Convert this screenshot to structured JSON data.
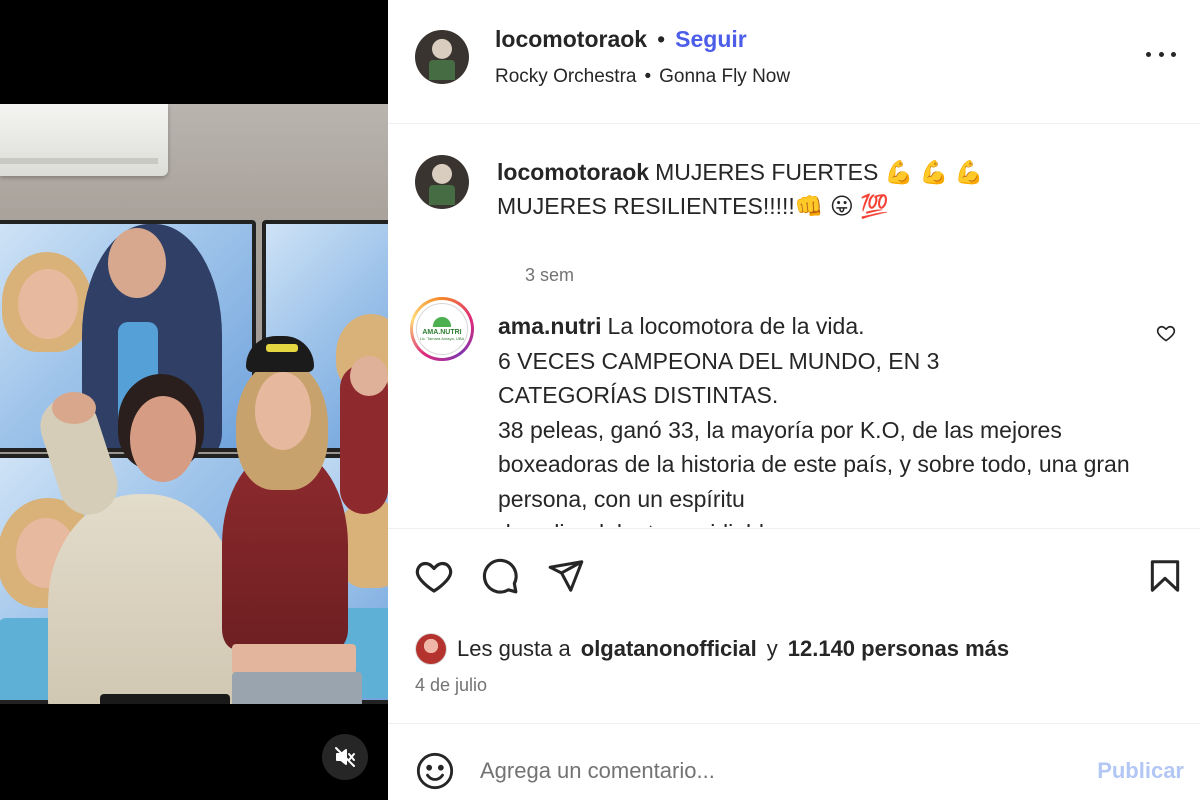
{
  "post": {
    "username": "locomotoraok",
    "separator": "•",
    "follow_label": "Seguir",
    "audio_artist": "Rocky Orchestra",
    "audio_separator": "•",
    "audio_track": "Gonna Fly Now"
  },
  "caption": {
    "username": "locomotoraok",
    "text": "MUJERES FUERTES 💪 💪 💪MUJERES RESILIENTES!!!!!👊 😛 💯",
    "time": "3 sem"
  },
  "comment": {
    "username": "ama.nutri",
    "avatar_brand": "AMA.NUTRI",
    "avatar_sub": "Lic. Tamara Amaya, UBA",
    "lines": [
      "La locomotora de la vida.",
      "6 VECES CAMPEONA DEL MUNDO, EN 3",
      "CATEGORÍAS DISTINTAS.",
      "38 peleas, ganó 33, la mayoría por K.O, de las mejores",
      "boxeadoras de la historia de este país, y sobre todo, una gran",
      "persona, con un espíritu",
      "de salir adelante envidiable."
    ]
  },
  "likes": {
    "prefix": "Les gusta a",
    "user": "olgatanonofficial",
    "connector": "y",
    "count_text": "12.140 personas más"
  },
  "date": "4 de julio",
  "comment_box": {
    "placeholder": "Agrega un comentario...",
    "publish_label": "Publicar"
  },
  "colors": {
    "accent": "#4c5de8",
    "publish_disabled": "#b3c7f5",
    "muted_text": "#737373",
    "primary_text": "#262626"
  },
  "icons": [
    "mute-icon",
    "more-options-icon",
    "heart-icon",
    "comment-icon",
    "share-icon",
    "bookmark-icon",
    "emoji-icon",
    "comment-like-heart-icon"
  ]
}
